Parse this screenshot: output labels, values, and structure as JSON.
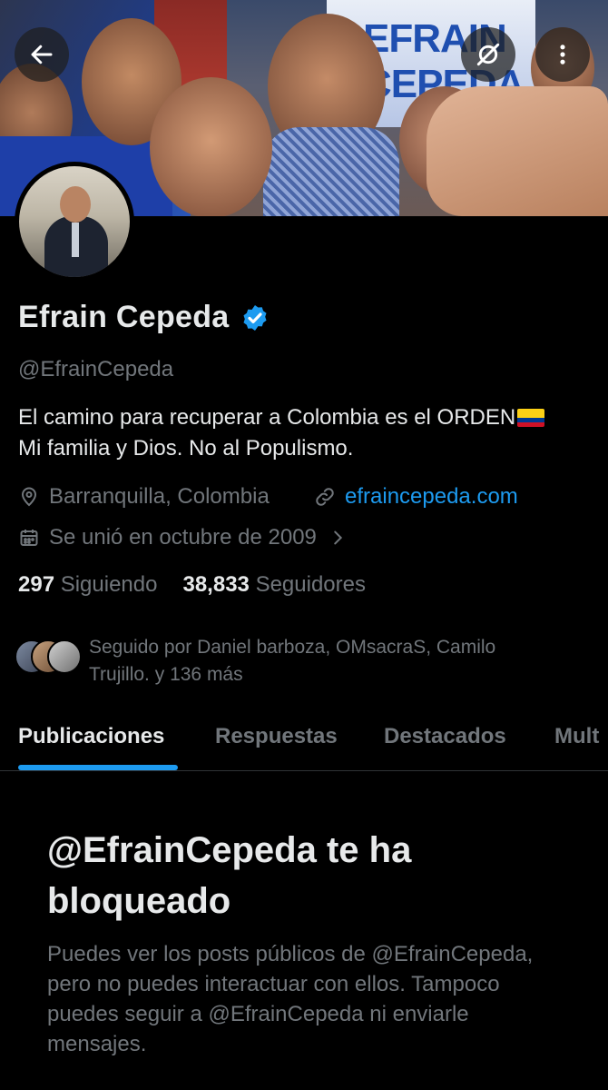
{
  "banner": {
    "poster_text": "EFRAIN CEPEDA"
  },
  "profile": {
    "display_name": "Efrain Cepeda",
    "handle": "@EfrainCepeda",
    "bio": "El camino para recuperar a Colombia es el ORDEN",
    "bio_line2": "Mi familia y Dios. No al Populismo.",
    "location": "Barranquilla, Colombia",
    "website": "efraincepeda.com",
    "joined": "Se unió en octubre de 2009",
    "following_count": "297",
    "following_label": "Siguiendo",
    "followers_count": "38,833",
    "followers_label": "Seguidores",
    "followed_by": "Seguido por Daniel barboza, OMsacraS, Camilo Trujillo. y 136 más"
  },
  "tabs": [
    {
      "label": "Publicaciones",
      "active": true
    },
    {
      "label": "Respuestas",
      "active": false
    },
    {
      "label": "Destacados",
      "active": false
    },
    {
      "label": "Mult",
      "active": false
    }
  ],
  "blocked": {
    "title": "@EfrainCepeda te ha bloqueado",
    "description": "Puedes ver los posts públicos de @EfrainCepeda, pero no puedes interactuar con ellos. Tampoco puedes seguir a @EfrainCepeda ni enviarle mensajes."
  },
  "colors": {
    "accent": "#1d9bf0",
    "background": "#000000",
    "secondary_text": "#71767b",
    "primary_text": "#e7e9ea"
  }
}
